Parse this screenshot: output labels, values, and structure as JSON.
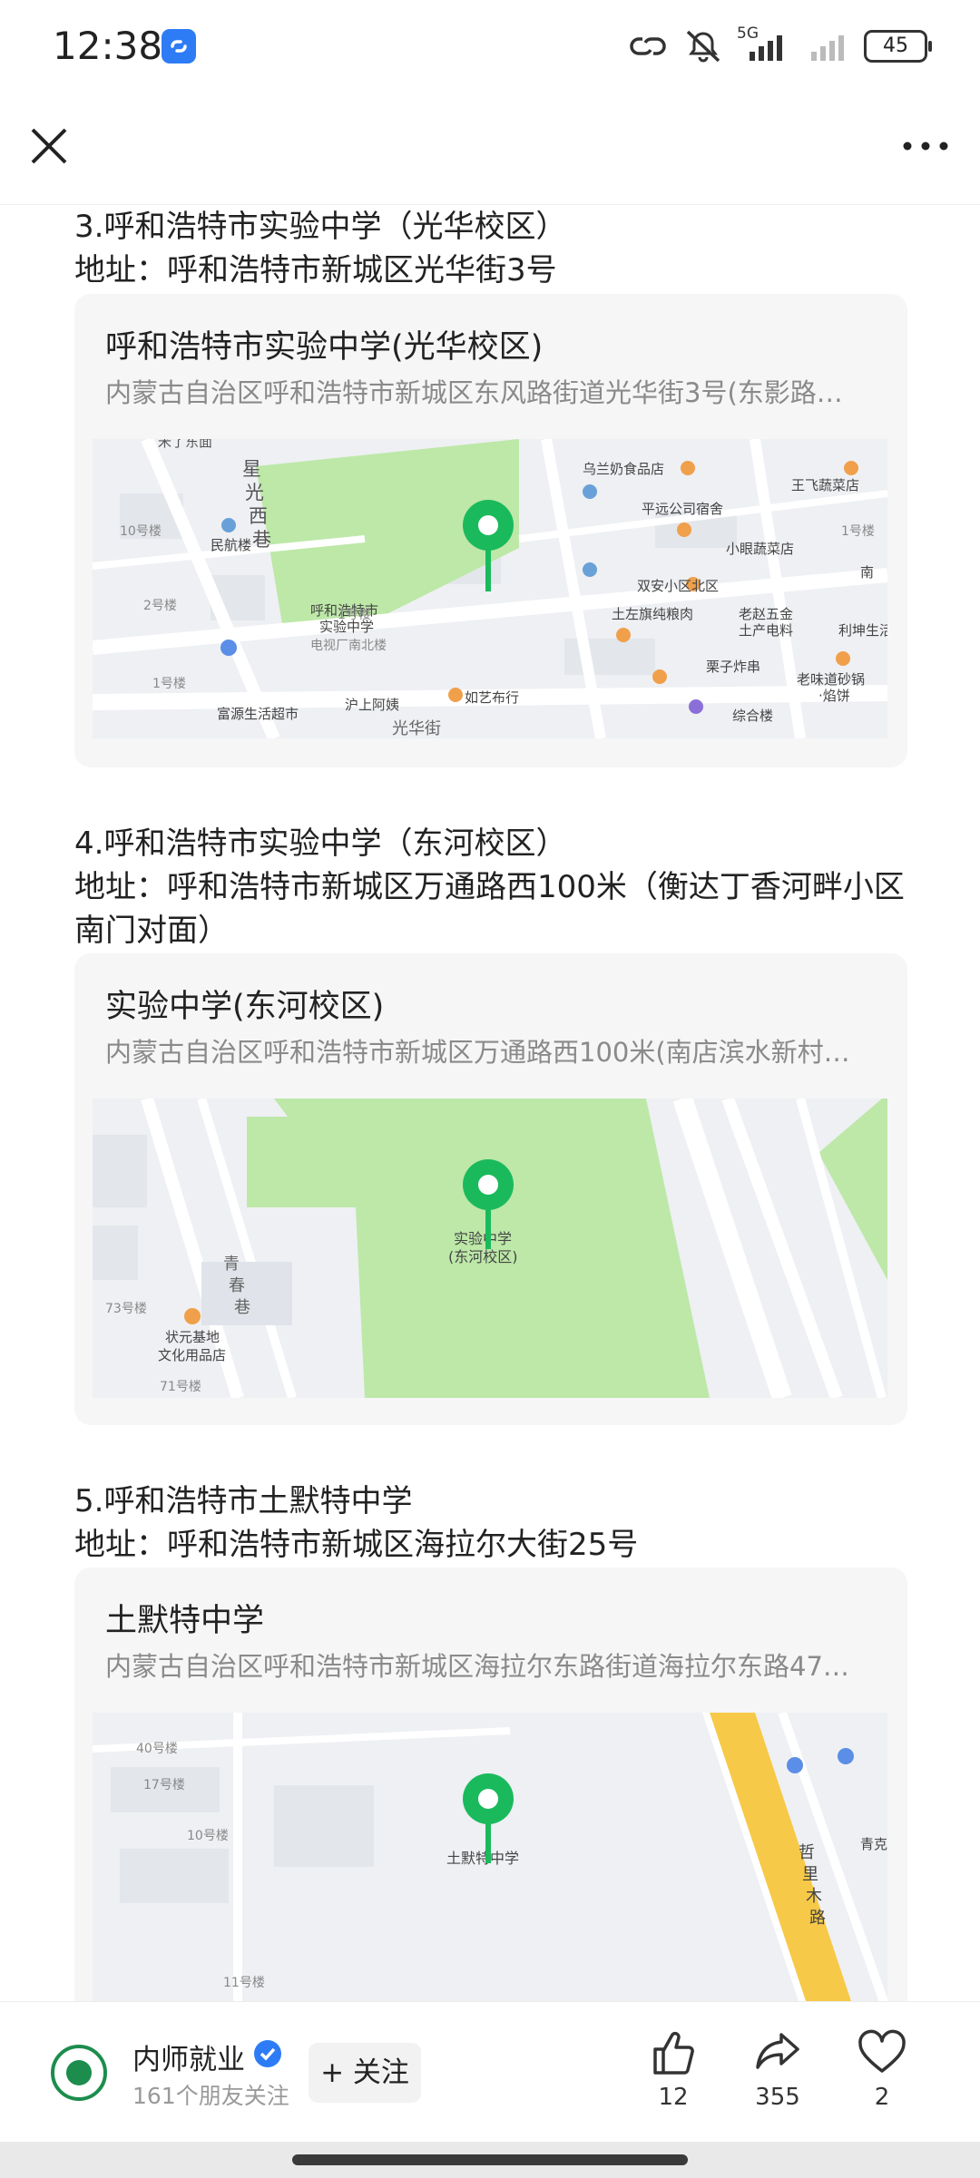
{
  "status_bar": {
    "time": "12:38",
    "network": "5G",
    "battery": "45"
  },
  "sections": [
    {
      "heading": "3.呼和浩特市实验中学（光华校区）",
      "address_line": "地址：呼和浩特市新城区光华街3号",
      "card": {
        "title": "呼和浩特市实验中学(光华校区)",
        "address": "内蒙古自治区呼和浩特市新城区东风路街道光华街3号(东影路…",
        "map_labels": [
          "星光西巷",
          "乌兰奶食品店",
          "王飞蔬菜店",
          "平远公司宿舍",
          "10号楼",
          "民航楼",
          "小眼蔬菜店",
          "双安小区北区",
          "呼和浩特市实验中学",
          "土左旗纯粮肉",
          "老赵五金土产电料",
          "利坤生活",
          "2号楼",
          "1号楼",
          "电视厂南北楼",
          "栗子炸串",
          "1号楼",
          "沪上阿姨",
          "如艺布行",
          "老味道砂锅·焰饼",
          "富源生活超市",
          "综合楼",
          "光华街",
          "南"
        ]
      }
    },
    {
      "heading": "4.呼和浩特市实验中学（东河校区）",
      "address_line": "地址：呼和浩特市新城区万通路西100米（衡达丁香河畔小区南门对面）",
      "card": {
        "title": "实验中学(东河校区)",
        "address": "内蒙古自治区呼和浩特市新城区万通路西100米(南店滨水新村…",
        "map_labels": [
          "实验中学(东河校区)",
          "青春巷",
          "73号楼",
          "状元基地文化用品店",
          "71号楼"
        ]
      }
    },
    {
      "heading": "5.呼和浩特市土默特中学",
      "address_line": "地址：呼和浩特市新城区海拉尔大街25号",
      "card": {
        "title": "土默特中学",
        "address": "内蒙古自治区呼和浩特市新城区海拉尔东路街道海拉尔东路47…",
        "map_labels": [
          "40号楼",
          "17号楼",
          "10号楼",
          "土默特中学",
          "哲里木路",
          "11号楼",
          "青克"
        ]
      }
    }
  ],
  "bottom_bar": {
    "author": "内师就业",
    "followers": "161个朋友关注",
    "follow_label": "+ 关注",
    "likes": "12",
    "shares": "355",
    "favorites": "2"
  },
  "colors": {
    "pin_green": "#1aba5c",
    "park_green": "#bde8a8",
    "road_yellow": "#f7c948",
    "accent_blue": "#2d7cf6"
  }
}
